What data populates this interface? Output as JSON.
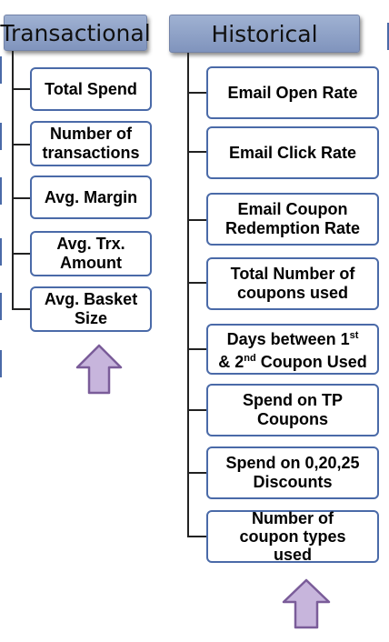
{
  "transactional": {
    "title": "Transactional",
    "items": [
      {
        "lines": [
          "Total Spend"
        ]
      },
      {
        "lines": [
          "Number of",
          "transactions"
        ]
      },
      {
        "lines": [
          "Avg. Margin"
        ]
      },
      {
        "lines": [
          "Avg. Trx.",
          "Amount"
        ]
      },
      {
        "lines": [
          "Avg. Basket",
          "Size"
        ]
      }
    ]
  },
  "historical": {
    "title": "Historical",
    "items": [
      {
        "lines": [
          "Email Open Rate"
        ]
      },
      {
        "lines": [
          "Email Click Rate"
        ]
      },
      {
        "lines": [
          "Email Coupon",
          "Redemption Rate"
        ]
      },
      {
        "lines": [
          "Total Number of",
          "coupons used"
        ]
      },
      {
        "lines": [
          "Days between 1",
          "& 2",
          "Coupon Used"
        ],
        "sup1": "st",
        "sup2": "nd"
      },
      {
        "lines": [
          "Spend on TP",
          "Coupons"
        ]
      },
      {
        "lines": [
          "Spend on 0,20,25",
          "Discounts"
        ]
      },
      {
        "lines": [
          "Number of",
          "coupon types",
          "used"
        ]
      }
    ]
  },
  "colors": {
    "header_fill": "#8fa3c8",
    "box_border": "#4a6aa8",
    "arrow_fill": "#c7b5dc",
    "arrow_stroke": "#7a5c99"
  }
}
